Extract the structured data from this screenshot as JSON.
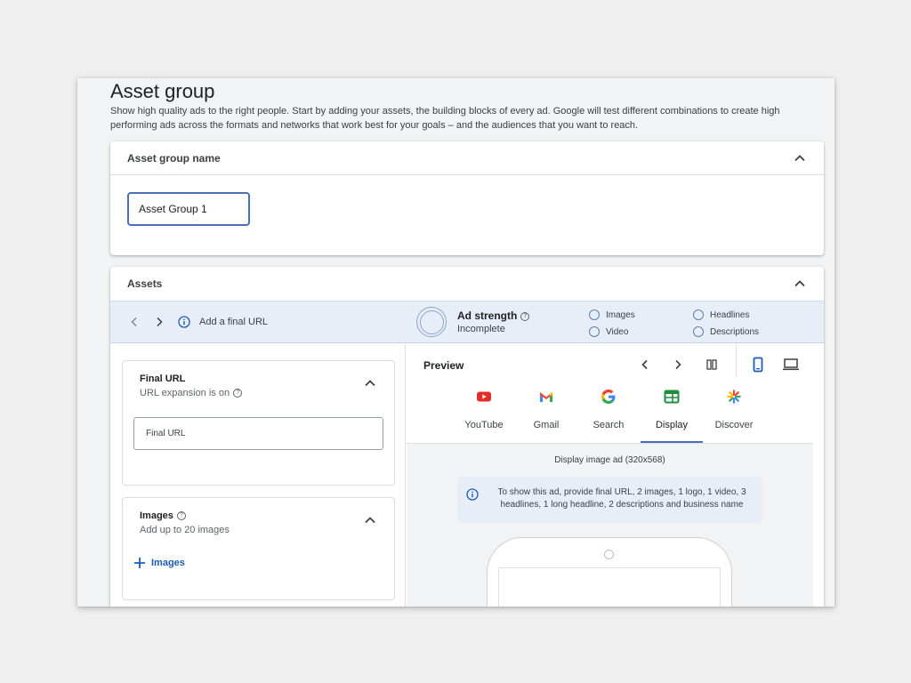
{
  "page": {
    "title": "Asset group",
    "description": "Show high quality ads to the right people. Start by adding your assets, the building blocks of every ad. Google will test different combinations to create high performing ads across the formats and networks that work best for your goals – and the audiences that you want to reach."
  },
  "asset_group_name": {
    "header": "Asset group name",
    "input_value": "Asset Group 1"
  },
  "assets": {
    "header": "Assets",
    "hint": "Add a final URL",
    "ad_strength": {
      "label": "Ad strength",
      "status": "Incomplete",
      "checklist": [
        "Images",
        "Video",
        "Headlines",
        "Descriptions"
      ]
    },
    "final_url": {
      "title": "Final URL",
      "subtitle": "URL expansion is on",
      "placeholder": "Final URL"
    },
    "images": {
      "title": "Images",
      "subtitle": "Add up to 20 images",
      "add_label": "Images"
    }
  },
  "preview": {
    "title": "Preview",
    "channels": [
      {
        "label": "YouTube",
        "icon": "youtube-icon"
      },
      {
        "label": "Gmail",
        "icon": "gmail-icon"
      },
      {
        "label": "Search",
        "icon": "google-icon"
      },
      {
        "label": "Display",
        "icon": "display-icon"
      },
      {
        "label": "Discover",
        "icon": "discover-icon"
      }
    ],
    "selected_channel": "Display",
    "ad_format": "Display image ad (320x568)",
    "notice": "To show this ad, provide final URL, 2 images, 1 logo, 1 video, 3 headlines, 1 long headline, 2 descriptions and business name"
  },
  "colors": {
    "accent": "#1a73e8",
    "info_bar": "#e8eef7"
  }
}
